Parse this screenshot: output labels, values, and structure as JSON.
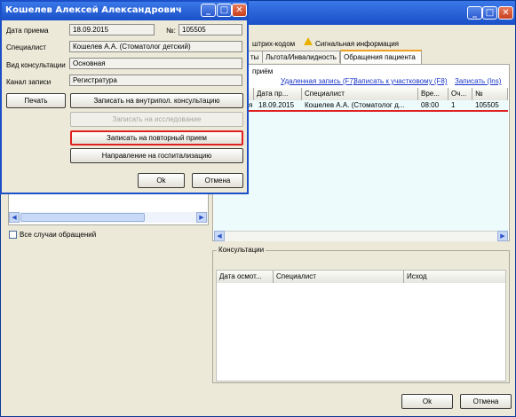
{
  "main": {
    "toolbar": {
      "barcode_label": "штрих-кодом",
      "signal_label": "Сигнальная информация"
    },
    "tabs": [
      {
        "label": "ты"
      },
      {
        "label": "Льгота/Инвалидность"
      },
      {
        "label": "Обращения пациента"
      }
    ],
    "visits_group_label": "приём",
    "links": [
      {
        "label": "Удаленная запись (F7)"
      },
      {
        "label": "Записать к участковому (F8)"
      },
      {
        "label": "Записать (Ins)"
      }
    ],
    "visits_table": {
      "columns": [
        "Дата пр...",
        "Специалист",
        "Вре...",
        "Оч...",
        "№"
      ],
      "rows": [
        {
          "prefix": "я",
          "date": "18.09.2015",
          "specialist": "Кошелев А.А. (Стоматолог д...",
          "time": "08:00",
          "queue": "1",
          "num": "105505"
        }
      ]
    },
    "all_cases_label": "Все случаи обращений",
    "consult_group_label": "Консультации",
    "consult_table": {
      "columns": [
        "Дата осмот...",
        "Специалист",
        "Исход"
      ]
    },
    "ok_label": "Ok",
    "cancel_label": "Отмена"
  },
  "dialog": {
    "title": "Кошелев Алексей Александрович",
    "fields": {
      "date_label": "Дата приема",
      "date_value": "18.09.2015",
      "num_label": "№:",
      "num_value": "105505",
      "specialist_label": "Специалист",
      "specialist_value": "Кошелев А.А. (Стоматолог детский)",
      "consult_type_label": "Вид консультации",
      "consult_type_value": "Основная",
      "channel_label": "Канал записи",
      "channel_value": "Регистратура"
    },
    "print_label": "Печать",
    "actions": [
      {
        "label": "Записать на внутрипол. консультацию"
      },
      {
        "label": "Записать на исследование"
      },
      {
        "label": "Записать на повторный прием"
      },
      {
        "label": "Направление на госпитализацию"
      }
    ],
    "ok_label": "Ok",
    "cancel_label": "Отмена"
  }
}
